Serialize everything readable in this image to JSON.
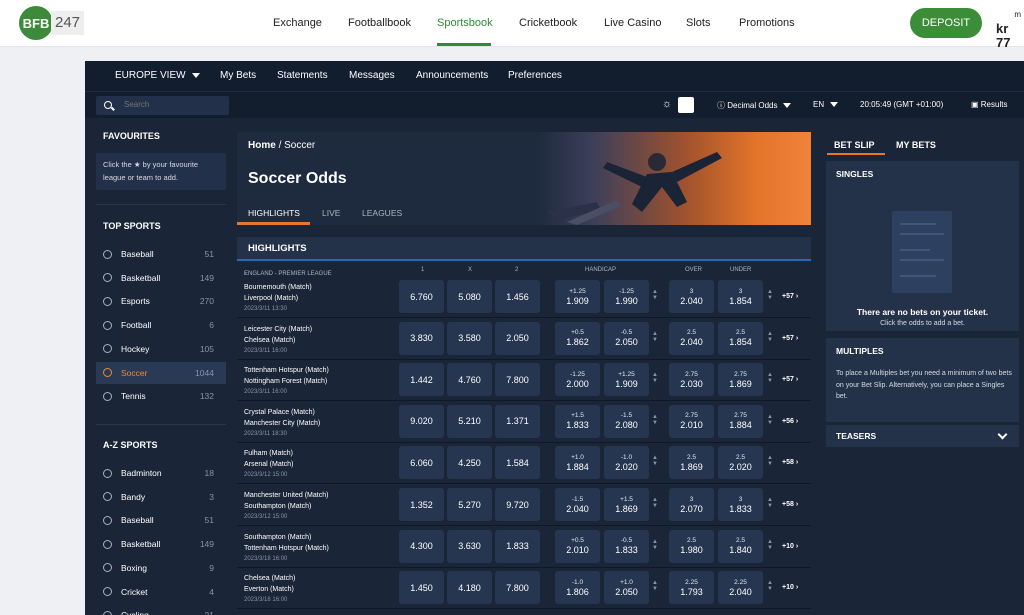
{
  "brand": {
    "logo_text": "BFB",
    "logo_num": "247",
    "deposit": "DEPOSIT",
    "account_line1": "m",
    "account_balance": "kr 77"
  },
  "topnav": [
    "Exchange",
    "Footballbook",
    "Sportsbook",
    "Cricketbook",
    "Live Casino",
    "Slots",
    "Promotions"
  ],
  "subnav": {
    "view": "EUROPE VIEW",
    "items": [
      "My Bets",
      "Statements",
      "Messages",
      "Announcements",
      "Preferences"
    ]
  },
  "toolbar": {
    "search_placeholder": "Search",
    "odds_format": "Decimal Odds",
    "language": "EN",
    "clock": "20:05:49 (GMT +01:00)",
    "results": "Results"
  },
  "sidebar": {
    "favourites_title": "FAVOURITES",
    "favourites_hint_a": "Click the ",
    "favourites_hint_b": " by your favourite league or team to add.",
    "top_title": "TOP SPORTS",
    "top": [
      {
        "label": "Baseball",
        "count": "51"
      },
      {
        "label": "Basketball",
        "count": "149"
      },
      {
        "label": "Esports",
        "count": "270"
      },
      {
        "label": "Football",
        "count": "6"
      },
      {
        "label": "Hockey",
        "count": "105"
      },
      {
        "label": "Soccer",
        "count": "1044"
      },
      {
        "label": "Tennis",
        "count": "132"
      }
    ],
    "az_title": "A-Z SPORTS",
    "az": [
      {
        "label": "Badminton",
        "count": "18"
      },
      {
        "label": "Bandy",
        "count": "3"
      },
      {
        "label": "Baseball",
        "count": "51"
      },
      {
        "label": "Basketball",
        "count": "149"
      },
      {
        "label": "Boxing",
        "count": "9"
      },
      {
        "label": "Cricket",
        "count": "4"
      },
      {
        "label": "Cycling",
        "count": "21"
      }
    ]
  },
  "main": {
    "breadcrumb_home": "Home",
    "breadcrumb_sep": "/",
    "breadcrumb_current": "Soccer",
    "title": "Soccer Odds",
    "tabs": [
      "HIGHLIGHTS",
      "LIVE",
      "LEAGUES"
    ],
    "section": "HIGHLIGHTS",
    "columns": {
      "league": "ENGLAND - PREMIER LEAGUE",
      "c1": "1",
      "cx": "X",
      "c2": "2",
      "handicap": "HANDICAP",
      "over": "OVER",
      "under": "UNDER"
    },
    "events": [
      {
        "home": "Bournemouth (Match)",
        "away": "Liverpool (Match)",
        "date": "2023/3/11 13:30",
        "o1": "6.760",
        "ox": "5.080",
        "o2": "1.456",
        "h1": "+1.25",
        "h1o": "1.909",
        "h2": "-1.25",
        "h2o": "1.990",
        "ov": "3",
        "ovo": "2.040",
        "un": "3",
        "uno": "1.854",
        "more": "+57"
      },
      {
        "home": "Leicester City (Match)",
        "away": "Chelsea (Match)",
        "date": "2023/3/11 16:00",
        "o1": "3.830",
        "ox": "3.580",
        "o2": "2.050",
        "h1": "+0.5",
        "h1o": "1.862",
        "h2": "-0.5",
        "h2o": "2.050",
        "ov": "2.5",
        "ovo": "2.040",
        "un": "2.5",
        "uno": "1.854",
        "more": "+57"
      },
      {
        "home": "Tottenham Hotspur (Match)",
        "away": "Nottingham Forest (Match)",
        "date": "2023/3/11 16:00",
        "o1": "1.442",
        "ox": "4.760",
        "o2": "7.800",
        "h1": "-1.25",
        "h1o": "2.000",
        "h2": "+1.25",
        "h2o": "1.909",
        "ov": "2.75",
        "ovo": "2.030",
        "un": "2.75",
        "uno": "1.869",
        "more": "+57"
      },
      {
        "home": "Crystal Palace (Match)",
        "away": "Manchester City (Match)",
        "date": "2023/3/11 18:30",
        "o1": "9.020",
        "ox": "5.210",
        "o2": "1.371",
        "h1": "+1.5",
        "h1o": "1.833",
        "h2": "-1.5",
        "h2o": "2.080",
        "ov": "2.75",
        "ovo": "2.010",
        "un": "2.75",
        "uno": "1.884",
        "more": "+56"
      },
      {
        "home": "Fulham (Match)",
        "away": "Arsenal (Match)",
        "date": "2023/3/12 15:00",
        "o1": "6.060",
        "ox": "4.250",
        "o2": "1.584",
        "h1": "+1.0",
        "h1o": "1.884",
        "h2": "-1.0",
        "h2o": "2.020",
        "ov": "2.5",
        "ovo": "1.869",
        "un": "2.5",
        "uno": "2.020",
        "more": "+58"
      },
      {
        "home": "Manchester United (Match)",
        "away": "Southampton (Match)",
        "date": "2023/3/12 15:00",
        "o1": "1.352",
        "ox": "5.270",
        "o2": "9.720",
        "h1": "-1.5",
        "h1o": "2.040",
        "h2": "+1.5",
        "h2o": "1.869",
        "ov": "3",
        "ovo": "2.070",
        "un": "3",
        "uno": "1.833",
        "more": "+58"
      },
      {
        "home": "Southampton (Match)",
        "away": "Tottenham Hotspur (Match)",
        "date": "2023/3/18 16:00",
        "o1": "4.300",
        "ox": "3.630",
        "o2": "1.833",
        "h1": "+0.5",
        "h1o": "2.010",
        "h2": "-0.5",
        "h2o": "1.833",
        "ov": "2.5",
        "ovo": "1.980",
        "un": "2.5",
        "uno": "1.840",
        "more": "+10"
      },
      {
        "home": "Chelsea (Match)",
        "away": "Everton (Match)",
        "date": "2023/3/18 16:00",
        "o1": "1.450",
        "ox": "4.180",
        "o2": "7.800",
        "h1": "-1.0",
        "h1o": "1.806",
        "h2": "+1.0",
        "h2o": "2.050",
        "ov": "2.25",
        "ovo": "1.793",
        "un": "2.25",
        "uno": "2.040",
        "more": "+10"
      }
    ]
  },
  "betslip": {
    "tab1": "BET SLIP",
    "tab2": "MY BETS",
    "singles": "SINGLES",
    "empty_title": "There are no bets on your ticket.",
    "empty_sub": "Click the odds to add a bet.",
    "multiples": "MULTIPLES",
    "multiples_text": "To place a Multiples bet you need a minimum of two bets on your Bet Slip. Alternatively, you can place a Singles bet.",
    "teasers": "TEASERS"
  },
  "colors": {
    "accent_green": "#3b8d37",
    "accent_orange": "#e8772c",
    "bg_dark": "#1a2538"
  }
}
